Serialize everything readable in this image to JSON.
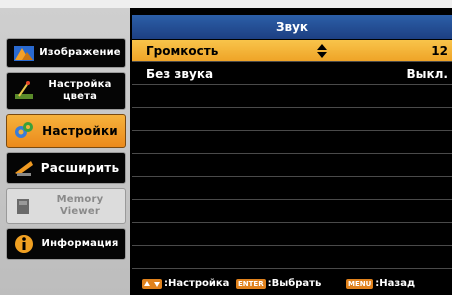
{
  "sidebar": {
    "items": [
      {
        "label": "Изображение",
        "icon": "image-icon",
        "state": "normal"
      },
      {
        "label_line1": "Настройка",
        "label_line2": "цвета",
        "icon": "color-adjust-icon",
        "state": "normal"
      },
      {
        "label": "Настройки",
        "icon": "settings-icon",
        "state": "active"
      },
      {
        "label": "Расширить",
        "icon": "extend-icon",
        "state": "normal"
      },
      {
        "label_line1": "Memory",
        "label_line2": "Viewer",
        "icon": "memory-viewer-icon",
        "state": "disabled"
      },
      {
        "label": "Информация",
        "icon": "info-icon",
        "state": "normal"
      }
    ]
  },
  "panel": {
    "title": "Звук",
    "rows": [
      {
        "name": "Громкость",
        "value": "12",
        "selected": true
      },
      {
        "name": "Без звука",
        "value": "Выкл.",
        "selected": false
      }
    ]
  },
  "footer": {
    "adjust_label": ":Настройка",
    "enter_key": "ENTER",
    "select_label": ":Выбрать",
    "menu_key": "MENU",
    "back_label": ":Назад"
  },
  "colors": {
    "header_blue": "#1d3f82",
    "highlight_orange": "#f0a82a",
    "background": "#000000",
    "sidebar_gray": "#c8c8c8"
  }
}
